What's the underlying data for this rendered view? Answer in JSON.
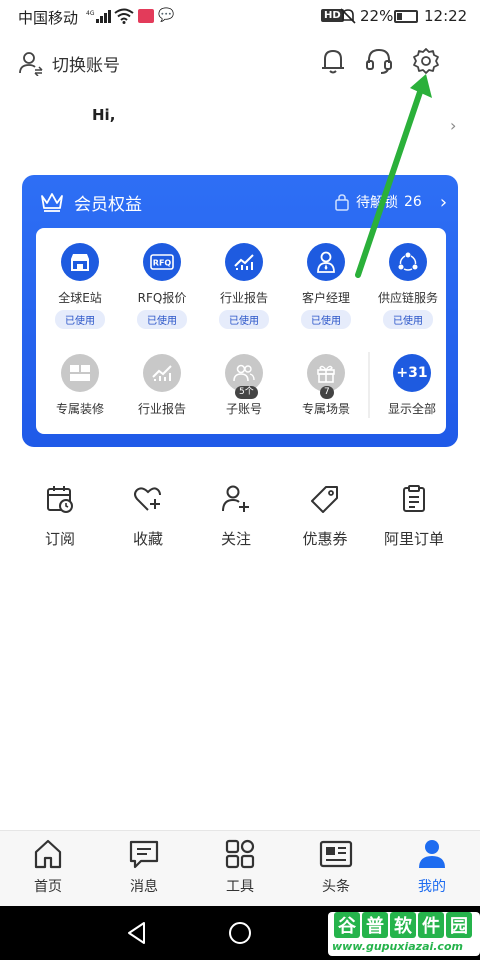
{
  "status_bar": {
    "carrier": "中国移动",
    "network": "4G",
    "hd": "HD",
    "battery": "22%",
    "time": "12:22"
  },
  "header": {
    "switch_account": "切换账号",
    "icons": [
      "bell-icon",
      "headset-icon",
      "gear-icon"
    ]
  },
  "greeting": "Hi,",
  "member_card": {
    "title": "会员权益",
    "unlock_label": "待解锁",
    "unlock_count": "26",
    "row1": [
      {
        "label": "全球E站",
        "badge": "已使用",
        "icon": "store-icon"
      },
      {
        "label": "RFQ报价",
        "badge": "已使用",
        "icon": "rfq-icon"
      },
      {
        "label": "行业报告",
        "badge": "已使用",
        "icon": "chart-icon"
      },
      {
        "label": "客户经理",
        "badge": "已使用",
        "icon": "manager-icon"
      },
      {
        "label": "供应链服务",
        "badge": "已使用",
        "icon": "share-icon"
      }
    ],
    "row2": [
      {
        "label": "专属装修",
        "icon": "layout-icon"
      },
      {
        "label": "行业报告",
        "icon": "chart-icon"
      },
      {
        "label": "子账号",
        "count": "5个",
        "icon": "users-icon"
      },
      {
        "label": "专属场景",
        "count": "7",
        "icon": "gift-icon"
      }
    ],
    "show_all": {
      "count": "+31",
      "label": "显示全部"
    }
  },
  "quick_actions": [
    {
      "label": "订阅",
      "icon": "calendar-clock-icon"
    },
    {
      "label": "收藏",
      "icon": "heart-plus-icon"
    },
    {
      "label": "关注",
      "icon": "user-plus-icon"
    },
    {
      "label": "优惠券",
      "icon": "tag-icon"
    },
    {
      "label": "阿里订单",
      "icon": "clipboard-icon"
    }
  ],
  "tabs": [
    {
      "label": "首页",
      "icon": "home-icon",
      "active": false
    },
    {
      "label": "消息",
      "icon": "message-icon",
      "active": false
    },
    {
      "label": "工具",
      "icon": "grid-icon",
      "active": false
    },
    {
      "label": "头条",
      "icon": "news-icon",
      "active": false
    },
    {
      "label": "我的",
      "icon": "person-icon",
      "active": true
    }
  ],
  "watermark": {
    "chars": [
      "谷",
      "普",
      "软",
      "件",
      "园"
    ],
    "url": "www.gupuxiazai.com"
  },
  "colors": {
    "accent": "#1e5be0",
    "tab_active": "#1e6cf0",
    "arrow": "#2bb03a"
  }
}
